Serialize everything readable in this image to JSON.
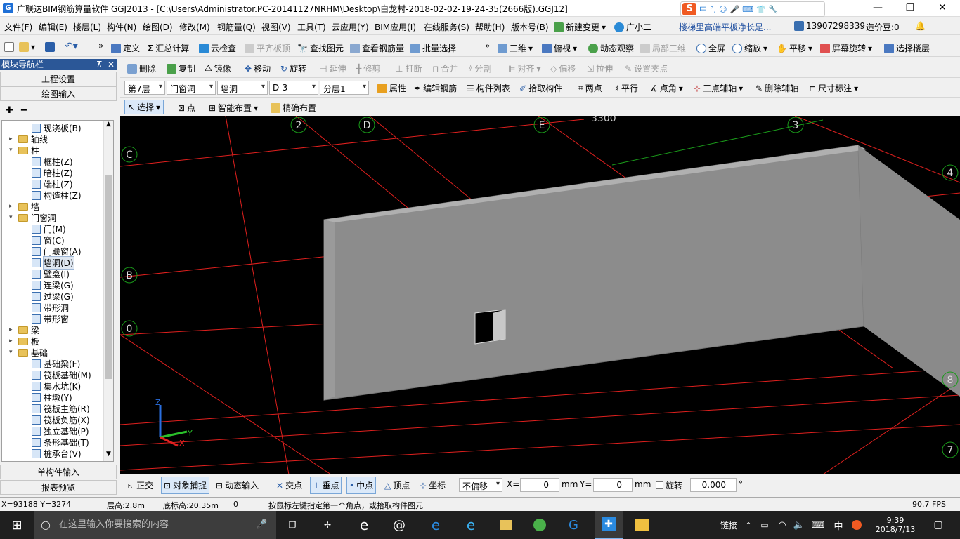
{
  "app": {
    "title": "广联达BIM钢筋算量软件 GGJ2013 - [C:\\Users\\Administrator.PC-20141127NRHM\\Desktop\\白龙村-2018-02-02-19-24-35(2666版).GGJ12]",
    "icon_letter": "G"
  },
  "ime": {
    "logo": "S",
    "items": [
      "中",
      "°,",
      "☺",
      "🎤",
      "⌨",
      "👕",
      "🔧"
    ]
  },
  "window_controls": {
    "minimize": "—",
    "maximize": "❐",
    "close": "✕"
  },
  "menubar": [
    "文件(F)",
    "编辑(E)",
    "楼层(L)",
    "构件(N)",
    "绘图(D)",
    "修改(M)",
    "钢筋量(Q)",
    "视图(V)",
    "工具(T)",
    "云应用(Y)",
    "BIM应用(I)",
    "在线服务(S)",
    "帮助(H)",
    "版本号(B)"
  ],
  "menubar_right": {
    "new_change": "新建变更",
    "guangxiaoer": "广小二",
    "notice": "楼梯里高端平板净长是...",
    "phone": "13907298339",
    "zaojiadou": "造价豆:0"
  },
  "toolbar1": {
    "define": "定义",
    "sum": "汇总计算",
    "cloud_check": "云检查",
    "flat_top": "平齐板顶",
    "find": "查找图元",
    "view_rebar": "查看钢筋量",
    "batch_select": "批量选择",
    "three_d": "三维",
    "top_view": "俯视",
    "dynamic_view": "动态观察",
    "local_3d": "局部三维",
    "fullscreen": "全屏",
    "zoom": "缩放",
    "pan": "平移",
    "rotate_screen": "屏幕旋转",
    "select_floor": "选择楼层"
  },
  "toolbar2": {
    "delete": "删除",
    "copy": "复制",
    "mirror": "镜像",
    "move": "移动",
    "rotate": "旋转",
    "extend": "延伸",
    "trim": "修剪",
    "break": "打断",
    "merge": "合并",
    "split": "分割",
    "align": "对齐",
    "offset": "偏移",
    "stretch": "拉伸",
    "set_grip": "设置夹点"
  },
  "toolbar3": {
    "floor": "第7层",
    "category": "门窗洞",
    "type": "墙洞",
    "component": "D-3",
    "layer": "分层1",
    "property": "属性",
    "edit_rebar": "编辑钢筋",
    "component_list": "构件列表",
    "pick_component": "拾取构件",
    "two_points": "两点",
    "parallel": "平行",
    "point_angle": "点角",
    "three_point_axis": "三点辅轴",
    "delete_axis": "删除辅轴",
    "dimension": "尺寸标注"
  },
  "toolbar4": {
    "select": "选择",
    "point": "点",
    "smart_layout": "智能布置",
    "precise_layout": "精确布置"
  },
  "nav": {
    "header": "模块导航栏",
    "pin": "⊼",
    "close": "✕",
    "engineering_settings": "工程设置",
    "drawing_input": "绘图输入",
    "single_component_input": "单构件输入",
    "report_preview": "报表预览",
    "tree": [
      {
        "label": "现浇板(B)",
        "level": 2,
        "type": "leaf"
      },
      {
        "label": "轴线",
        "level": 1,
        "type": "folder",
        "expanded": false
      },
      {
        "label": "柱",
        "level": 1,
        "type": "folder",
        "expanded": true
      },
      {
        "label": "框柱(Z)",
        "level": 2,
        "type": "leaf"
      },
      {
        "label": "暗柱(Z)",
        "level": 2,
        "type": "leaf"
      },
      {
        "label": "端柱(Z)",
        "level": 2,
        "type": "leaf"
      },
      {
        "label": "构造柱(Z)",
        "level": 2,
        "type": "leaf"
      },
      {
        "label": "墙",
        "level": 1,
        "type": "folder",
        "expanded": false
      },
      {
        "label": "门窗洞",
        "level": 1,
        "type": "folder",
        "expanded": true
      },
      {
        "label": "门(M)",
        "level": 2,
        "type": "leaf"
      },
      {
        "label": "窗(C)",
        "level": 2,
        "type": "leaf"
      },
      {
        "label": "门联窗(A)",
        "level": 2,
        "type": "leaf"
      },
      {
        "label": "墙洞(D)",
        "level": 2,
        "type": "leaf",
        "selected": true
      },
      {
        "label": "壁龛(I)",
        "level": 2,
        "type": "leaf"
      },
      {
        "label": "连梁(G)",
        "level": 2,
        "type": "leaf"
      },
      {
        "label": "过梁(G)",
        "level": 2,
        "type": "leaf"
      },
      {
        "label": "带形洞",
        "level": 2,
        "type": "leaf"
      },
      {
        "label": "带形窗",
        "level": 2,
        "type": "leaf"
      },
      {
        "label": "梁",
        "level": 1,
        "type": "folder",
        "expanded": false
      },
      {
        "label": "板",
        "level": 1,
        "type": "folder",
        "expanded": false
      },
      {
        "label": "基础",
        "level": 1,
        "type": "folder",
        "expanded": true
      },
      {
        "label": "基础梁(F)",
        "level": 2,
        "type": "leaf"
      },
      {
        "label": "筏板基础(M)",
        "level": 2,
        "type": "leaf"
      },
      {
        "label": "集水坑(K)",
        "level": 2,
        "type": "leaf"
      },
      {
        "label": "柱墩(Y)",
        "level": 2,
        "type": "leaf"
      },
      {
        "label": "筏板主筋(R)",
        "level": 2,
        "type": "leaf"
      },
      {
        "label": "筏板负筋(X)",
        "level": 2,
        "type": "leaf"
      },
      {
        "label": "独立基础(P)",
        "level": 2,
        "type": "leaf"
      },
      {
        "label": "条形基础(T)",
        "level": 2,
        "type": "leaf"
      },
      {
        "label": "桩承台(V)",
        "level": 2,
        "type": "leaf"
      }
    ]
  },
  "canvas": {
    "dimension_label": "3300",
    "axis_labels": [
      "2",
      "D",
      "E",
      "3",
      "4",
      "C",
      "B",
      "0",
      "7",
      "8"
    ],
    "axes": {
      "z": "Z",
      "y": "Y",
      "x": "X"
    },
    "bg_color": "#000000",
    "grid_color": "#e0201e",
    "wall_color": "#8c8c8c"
  },
  "snapbar": {
    "orthogonal": "正交",
    "object_snap": "对象捕捉",
    "dynamic_input": "动态输入",
    "intersection": "交点",
    "perpendicular": "垂点",
    "midpoint": "中点",
    "vertex": "顶点",
    "coordinate": "坐标",
    "offset_mode": "不偏移",
    "x_label": "X=",
    "x_value": "0",
    "y_label": "Y=",
    "y_value": "0",
    "unit": "mm",
    "rotate_label": "旋转",
    "rotate_value": "0.000",
    "degree": "°"
  },
  "statusbar": {
    "coords": "X=93188 Y=3274",
    "floor_height": "层高:2.8m",
    "base_height": "底标高:20.35m",
    "count": "0",
    "hint": "按鼠标左键指定第一个角点，或拾取构件图元",
    "fps": "90.7 FPS"
  },
  "taskbar": {
    "search_placeholder": "在这里输入你要搜索的内容",
    "link": "链接",
    "lang": "中",
    "time": "9:39",
    "date": "2018/7/13"
  }
}
